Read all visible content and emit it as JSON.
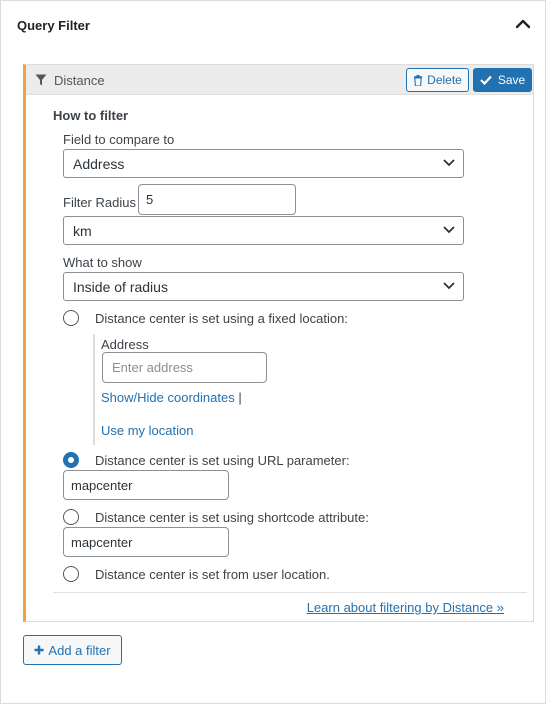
{
  "panel": {
    "title": "Query Filter",
    "collapse_icon": "chevron-up-icon"
  },
  "filter": {
    "icon": "funnel-icon",
    "name": "Distance",
    "delete_label": "Delete",
    "save_label": "Save",
    "section_title": "How to filter",
    "field_label": "Field to compare to",
    "field_value": "Address",
    "radius_label": "Filter Radius",
    "radius_value": "5",
    "unit_value": "km",
    "show_label": "What to show",
    "show_value": "Inside of radius",
    "options": [
      {
        "label": "Distance center is set using a fixed location:",
        "checked": false
      },
      {
        "label": "Distance center is set using URL parameter:",
        "checked": true
      },
      {
        "label": "Distance center is set using shortcode attribute:",
        "checked": false
      },
      {
        "label": "Distance center is set from user location.",
        "checked": false
      }
    ],
    "fixed_location": {
      "address_label": "Address",
      "address_placeholder": "Enter address",
      "toggle_coords_label": "Show/Hide coordinates",
      "separator": "|",
      "use_location_label": "Use my location"
    },
    "url_param_value": "mapcenter",
    "shortcode_attr_value": "mapcenter",
    "learn_link": "Learn about filtering by Distance »"
  },
  "add_filter_label": "Add a filter",
  "colors": {
    "accent": "#2271b1",
    "filter_border": "#f0a33c",
    "header_bg": "#ececec"
  }
}
